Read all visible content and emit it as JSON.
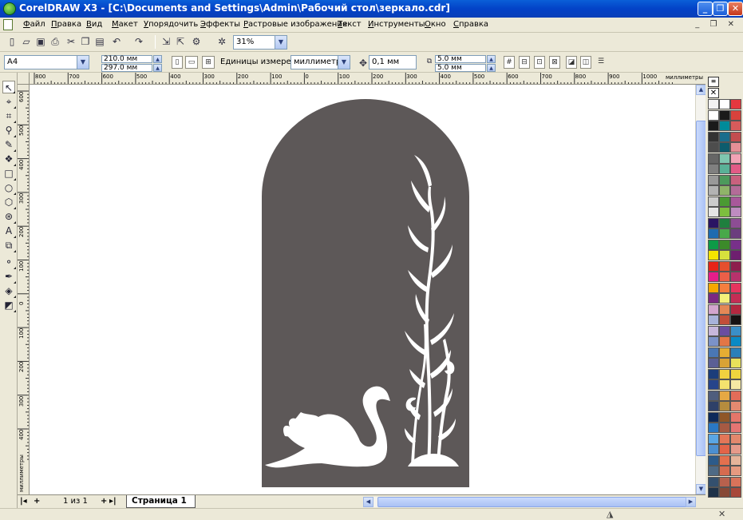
{
  "window": {
    "title": "CorelDRAW X3 - [C:\\Documents and Settings\\Admin\\Рабочий стол\\зеркало.cdr]",
    "minimize_glyph": "_",
    "maximize_glyph": "❐",
    "close_glyph": "✕"
  },
  "menu": {
    "items": [
      "Файл",
      "Правка",
      "Вид",
      "Макет",
      "Упорядочить",
      "Эффекты",
      "Растровые изображения",
      "Текст",
      "Инструменты",
      "Окно",
      "Справка"
    ],
    "mdi_controls": "_ ❐ ✕"
  },
  "standard_toolbar": {
    "icons": [
      "new-icon",
      "open-icon",
      "save-icon",
      "print-icon",
      "cut-icon",
      "copy-icon",
      "paste-icon",
      "undo-icon",
      "redo-icon",
      "import-icon",
      "export-icon",
      "launcher-icon",
      "welcome-icon"
    ],
    "zoom_value": "31%"
  },
  "property_bar": {
    "paper_type": "A4",
    "width": "210.0 мм",
    "height": "297.0 мм",
    "units_label": "Единицы измерения:",
    "units_value": "миллиметры",
    "nudge": "0,1 мм",
    "duplicate_x": "5.0 мм",
    "duplicate_y": "5.0 мм"
  },
  "rulers": {
    "horizontal_ticks": [
      "800",
      "700",
      "600",
      "500",
      "400",
      "300",
      "200",
      "100",
      "0",
      "100",
      "200",
      "300",
      "400",
      "500",
      "600",
      "700",
      "800",
      "900",
      "1000"
    ],
    "vertical_ticks": [
      "600",
      "500",
      "400",
      "300",
      "200",
      "100",
      "0",
      "100",
      "200",
      "300",
      "400"
    ],
    "units": "миллиметры"
  },
  "toolbox": {
    "tools": [
      "pick-tool-icon",
      "shape-tool-icon",
      "crop-tool-icon",
      "zoom-tool-icon",
      "freehand-tool-icon",
      "smart-fill-icon",
      "rectangle-tool-icon",
      "ellipse-tool-icon",
      "polygon-tool-icon",
      "basic-shapes-icon",
      "text-tool-icon",
      "interactive-blend-icon",
      "eyedropper-icon",
      "outline-tool-icon",
      "fill-tool-icon",
      "interactive-fill-icon"
    ]
  },
  "document": {
    "arch_fill": "#5d5858",
    "ornament_color": "#ffffff"
  },
  "page_nav": {
    "counter": "1 из 1",
    "tab_label": "Страница 1"
  },
  "palette_colors": [
    [
      "#f2f2f2",
      "#ffffff",
      "#e5373f"
    ],
    [
      "#ffffff",
      "#1a1a1a",
      "#d8423c"
    ],
    [
      "#1a1a1a",
      "#008b9a",
      "#d75b5b"
    ],
    [
      "#333333",
      "#1a6d8c",
      "#c34d4f"
    ],
    [
      "#4d4d4d",
      "#0d5c6d",
      "#e58f96"
    ],
    [
      "#666666",
      "#7fc6b0",
      "#f2a3b5"
    ],
    [
      "#808080",
      "#5ab197",
      "#e25b86"
    ],
    [
      "#999999",
      "#4d9a5c",
      "#c8617e"
    ],
    [
      "#b3b3b3",
      "#8fb469",
      "#b36c98"
    ],
    [
      "#cccccc",
      "#4a9a33",
      "#a8589a"
    ],
    [
      "#e6e6e6",
      "#7dbf3e",
      "#be8cc0"
    ],
    [
      "#2a1463",
      "#1f7f3e",
      "#8d4d94"
    ],
    [
      "#1f6bb0",
      "#49a84a",
      "#6b3d7e"
    ],
    [
      "#0d9a47",
      "#3c8a2a",
      "#78308a"
    ],
    [
      "#f5e400",
      "#d7e13d",
      "#6e1f6f"
    ],
    [
      "#e62418",
      "#e54f2e",
      "#8d1e4d"
    ],
    [
      "#e61e8a",
      "#ea5f48",
      "#b6326c"
    ],
    [
      "#f5a800",
      "#f47e3e",
      "#e6355e"
    ],
    [
      "#7b2982",
      "#f5f07a",
      "#c42d55"
    ],
    [
      "#d3a6ce",
      "#e48856",
      "#b32840"
    ],
    [
      "#a8b3d9",
      "#c24e3a",
      "#151212"
    ],
    [
      "#c7b7db",
      "#6a4da0",
      "#3a8fc7"
    ],
    [
      "#7b92c8",
      "#e37646",
      "#0a8ac5"
    ],
    [
      "#4a77b4",
      "#e5ad33",
      "#2a7fb8"
    ],
    [
      "#5b5f95",
      "#d9a235",
      "#e8e05a"
    ],
    [
      "#1c3d7a",
      "#f2d13f",
      "#efd43e"
    ],
    [
      "#26448b",
      "#f4e36e",
      "#f5e8a4"
    ],
    [
      "#4f5d7d",
      "#e6a844",
      "#e36c58"
    ],
    [
      "#2e4068",
      "#b68c3e",
      "#e48a70"
    ],
    [
      "#0d2a5a",
      "#8f5628",
      "#e4766a"
    ],
    [
      "#2a78c4",
      "#a65a43",
      "#e47573"
    ],
    [
      "#5aa6e4",
      "#e37658",
      "#e3886d"
    ],
    [
      "#4c8fd0",
      "#e36449",
      "#e69a8a"
    ],
    [
      "#2d5b8a",
      "#e3704e",
      "#e6b49a"
    ],
    [
      "#4e6a85",
      "#d76b4f",
      "#e79a80"
    ],
    [
      "#34506e",
      "#b8614d",
      "#d9735a"
    ],
    [
      "#1e3248",
      "#874836",
      "#a8483a"
    ]
  ]
}
